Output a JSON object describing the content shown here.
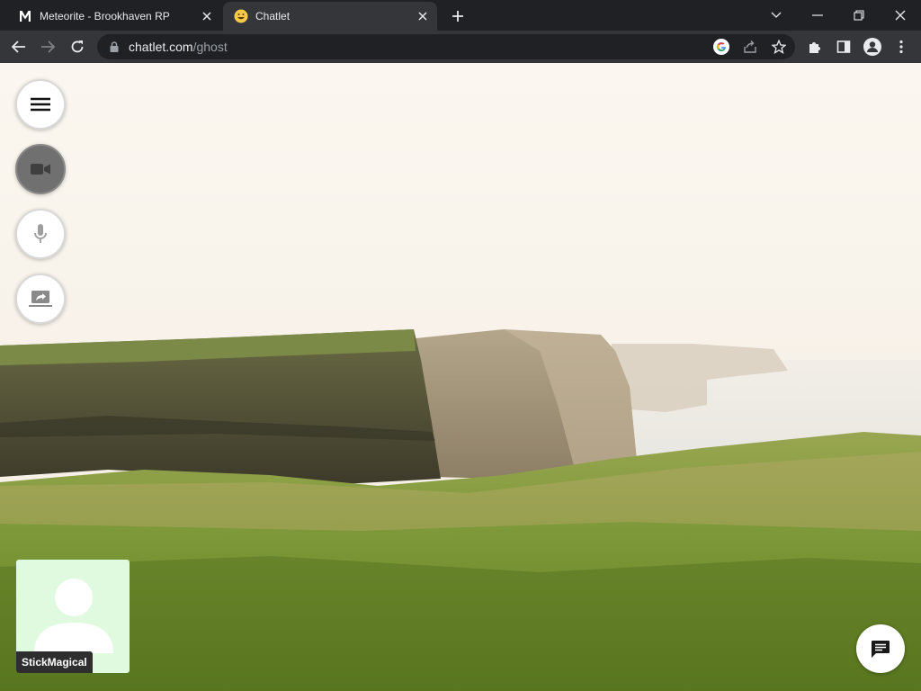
{
  "browser": {
    "tabs": [
      {
        "label": "Meteorite - Brookhaven RP",
        "favicon": "meteorite-m-icon",
        "active": false
      },
      {
        "label": "Chatlet",
        "favicon": "grinning-face-icon",
        "active": true
      }
    ],
    "url_host": "chatlet.com",
    "url_path": "/ghost"
  },
  "controls": {
    "menu_icon": "hamburger-menu-icon",
    "camera_icon": "video-camera-icon",
    "camera_state": "off",
    "mic_icon": "microphone-icon",
    "screen_share_icon": "screen-share-icon"
  },
  "self_view": {
    "username": "StickMagical",
    "avatar": "user-silhouette-icon"
  },
  "chat": {
    "icon": "chat-bubble-icon"
  },
  "background": "sea-cliffs-landscape",
  "colors": {
    "chrome_dark": "#202124",
    "chrome_toolbar": "#35363a",
    "self_tile_bg": "#dffadf"
  }
}
